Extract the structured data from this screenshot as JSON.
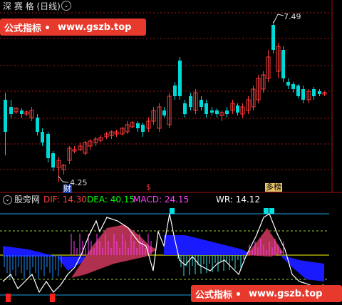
{
  "top_bar": {
    "title": "深 赛 格 (日线)",
    "menu_icon": "circle-chevron-down-icon"
  },
  "price_chart": {
    "high_label": "7.49",
    "low_label": "4.25",
    "marker_cai": "财",
    "marker_dollar": "$",
    "marker_bang": "多榜"
  },
  "indicator": {
    "name": "股旁网",
    "dif_label": "DIF:",
    "dif_value": "14.30",
    "dea_label": "DEA:",
    "dea_value": "40.15",
    "macd_label": "MACD:",
    "macd_value": "24.15",
    "wr_label": "WR:",
    "wr_value": "14.12"
  },
  "watermark_top": {
    "left": "公式指标",
    "right": "www.gszb.top"
  },
  "watermark_bottom": {
    "left": "公式指标",
    "right": "www.gszb.top"
  },
  "colors": {
    "up": "#ff3b3b",
    "down": "#00d8d8",
    "dif": "#ff4040",
    "dea": "#00ff00",
    "macd": "#ff40ff",
    "wr": "#ffffff",
    "grid": "#b01515",
    "watermark": "#e8392d"
  }
}
